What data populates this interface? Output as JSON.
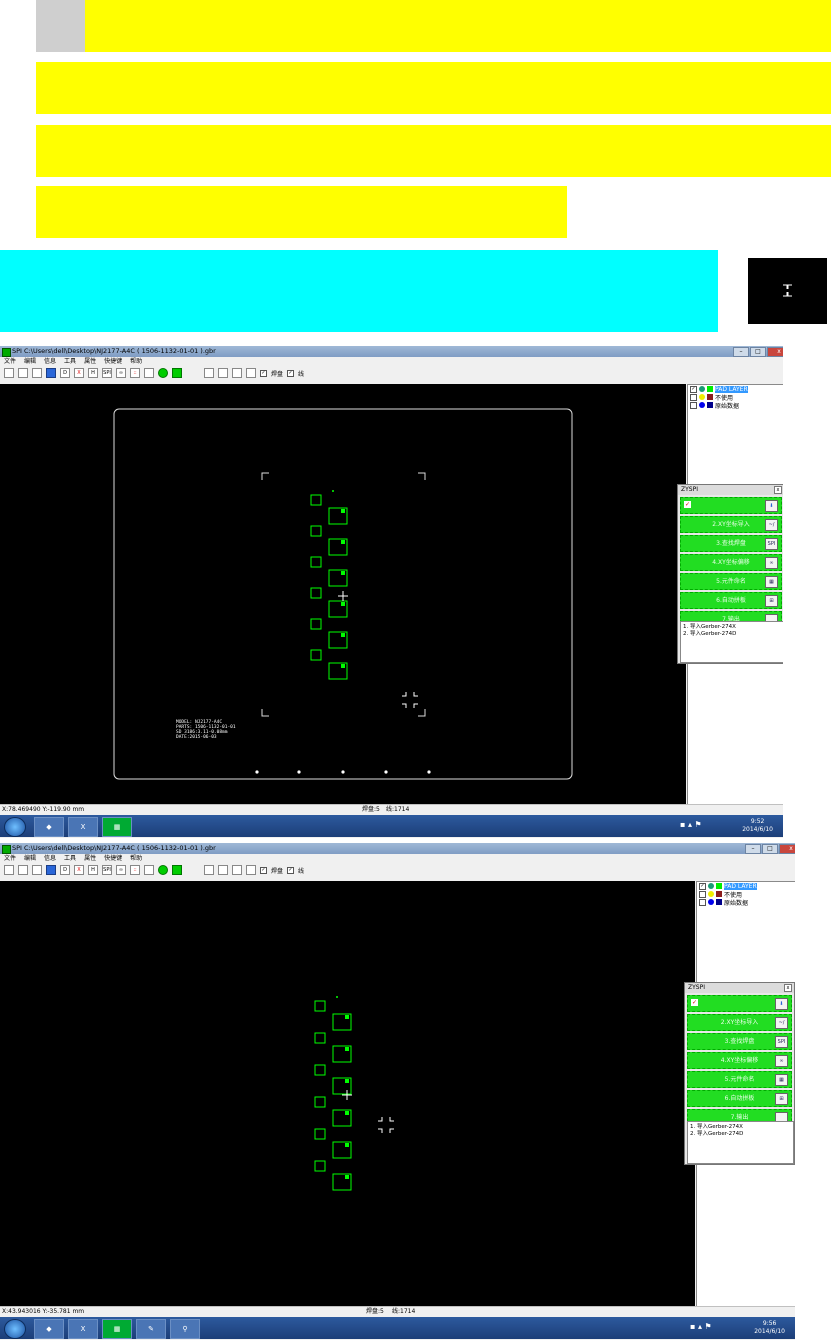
{
  "app": {
    "title_1": "SPI C:\\Users\\dell\\Desktop\\NJ2177-A4C ( 1506-1132-01-01 ).gbr",
    "title_2": "SPI C:\\Users\\dell\\Desktop\\NJ2177-A4C ( 1506-1132-01-01 ).gbr",
    "window_buttons": [
      "–",
      "□",
      "x"
    ]
  },
  "menu": [
    "文件",
    "编辑",
    "信息",
    "工具",
    "属性",
    "快捷键",
    "帮助"
  ],
  "toolbar": {
    "icons": [
      "new-icon",
      "open-icon",
      "save-icon",
      "download-icon",
      "d-icon",
      "x-icon",
      "h-icon",
      "spi-icon",
      "ng-icon",
      "dots-icon",
      "grid-icon",
      "green-dot-icon",
      "green-square-icon"
    ],
    "labels": [
      "",
      "",
      "",
      "",
      "D",
      "X",
      "H",
      "SPI",
      "∞",
      "::",
      "",
      "",
      ""
    ],
    "zoom_icons": [
      "zoom-fit-icon",
      "zoom-in-icon",
      "zoom-out-icon",
      "zoom-window-icon"
    ],
    "check_pad": "焊盘",
    "check_line": "线"
  },
  "layers": [
    {
      "name": "PAD LAYER",
      "checked": true,
      "circle": "#1a9b74",
      "square": "#00ee00",
      "selected": true
    },
    {
      "name": "不使用",
      "checked": false,
      "circle": "#f0f000",
      "square": "#8b1c1c",
      "selected": false
    },
    {
      "name": "原始数据",
      "checked": false,
      "circle": "#0000ee",
      "square": "#00008b",
      "selected": false
    }
  ],
  "zyspi": {
    "title": "ZYSPI",
    "close": "x",
    "buttons": [
      {
        "label": "",
        "icon": "⬇"
      },
      {
        "label": "2.XY坐标导入",
        "icon": "~/"
      },
      {
        "label": "3.查找焊盘",
        "icon": "SPI"
      },
      {
        "label": "4.XY坐标偏移",
        "icon": "∞"
      },
      {
        "label": "5.元件命名",
        "icon": "▦"
      },
      {
        "label": "6.自动拼板",
        "icon": "⊞"
      },
      {
        "label": "7.输出",
        "icon": ""
      }
    ],
    "log": [
      "1. 导入Gerber-274X",
      "2. 导入Gerber-274D"
    ]
  },
  "board_text": {
    "line1": "MODEL: NJ2177-A4C",
    "line2": "PARTS: 1506-1132-01-01",
    "line3": "SD 3186:3.11-0.08mm",
    "line4": "DATE:2015-06-03"
  },
  "status": {
    "coord_1": "X:78.469490 Y:-119.90 mm",
    "coord_2": "X:43.943016 Y:-35.781 mm",
    "pads": "焊盘:5",
    "lines": "线:1714"
  },
  "taskbar": {
    "time_1": "9:52",
    "date_1": "2014/6/10",
    "time_2": "9:56",
    "date_2": "2014/6/10"
  },
  "colors": {
    "highlight_yellow": "#ffff00",
    "highlight_cyan": "#00ffff",
    "pad_green": "#00ff00",
    "button_green": "#22dd22"
  }
}
